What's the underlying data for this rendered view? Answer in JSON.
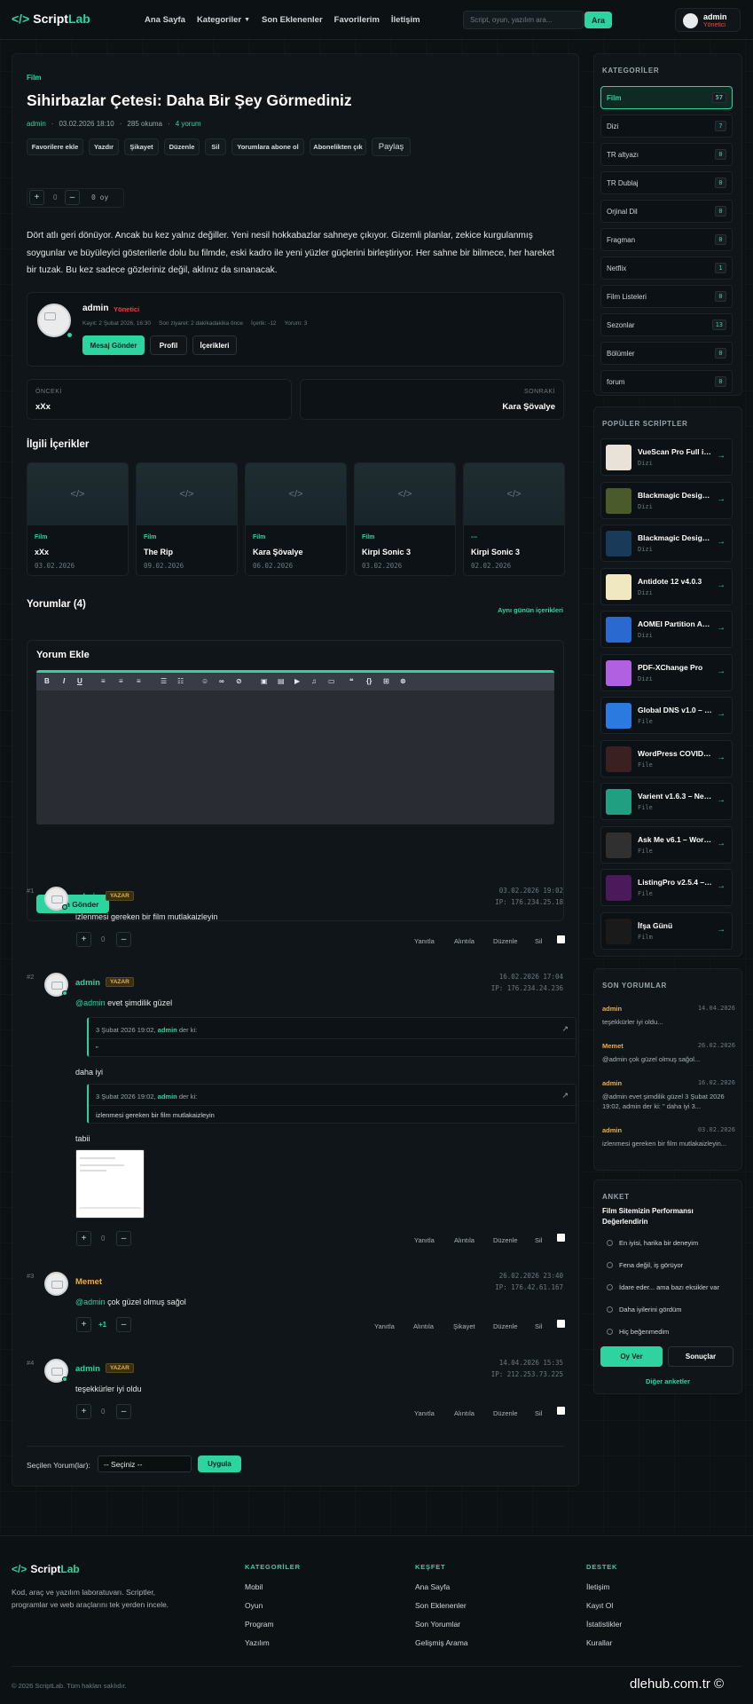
{
  "header": {
    "logo_bracket": "</>",
    "logo_script": "Script",
    "logo_lab": "Lab",
    "nav": [
      "Ana Sayfa",
      "Kategoriler",
      "Son Eklenenler",
      "Favorilerim",
      "İletişim"
    ],
    "search_placeholder": "Script, oyun, yazılım ara...",
    "search_button": "Ara",
    "user": {
      "name": "admin",
      "role": "Yönetici"
    }
  },
  "post": {
    "category": "Film",
    "title": "Sihirbazlar Çetesi: Daha Bir Şey Görmediniz",
    "author": "admin",
    "date": "03.02.2026 18:10",
    "reads": "285 okuma",
    "comments": "4 yorum",
    "actions": [
      "Favorilere ekle",
      "Yazdır",
      "Şikayet",
      "Düzenle",
      "Sil",
      "Yorumlara abone ol",
      "Abonelikten çık",
      "Paylaş"
    ],
    "vote": {
      "plus": "+",
      "count": "0",
      "minus": "–",
      "label": "0 oy"
    },
    "body": "Dört atlı geri dönüyor. Ancak bu kez yalnız değiller. Yeni nesil hokkabazlar sahneye çıkıyor. Gizemli planlar, zekice kurgulanmış soygunlar ve büyüleyici gösterilerle dolu bu filmde, eski kadro ile yeni yüzler güçlerini birleştiriyor. Her sahne bir bilmece, her hareket bir tuzak. Bu kez sadece gözleriniz değil, aklınız da sınanacak."
  },
  "author_card": {
    "name": "admin",
    "role": "Yönetici",
    "joined": "Kayıt: 2 Şubat 2026, 16:30",
    "last": "Son ziyaret: 2 dakikadakika önce",
    "content": "İçerik: -12",
    "comments": "Yorum: 3",
    "buttons": [
      "Mesaj Gönder",
      "Profil",
      "İçerikleri"
    ]
  },
  "prevnext": {
    "prev_label": "ÖNCEKİ",
    "prev_title": "xXx",
    "next_label": "SONRAKİ",
    "next_title": "Kara Şövalye"
  },
  "related": {
    "title": "İlgili İçerikler",
    "items": [
      {
        "cat": "Film",
        "title": "xXx",
        "date": "03.02.2026"
      },
      {
        "cat": "Film",
        "title": "The Rip",
        "date": "09.02.2026"
      },
      {
        "cat": "Film",
        "title": "Kara Şövalye",
        "date": "06.02.2026"
      },
      {
        "cat": "Film",
        "title": "Kirpi Sonic 3",
        "date": "03.02.2026"
      },
      {
        "cat": "---",
        "title": "Kirpi Sonic 3",
        "date": "02.02.2026"
      }
    ]
  },
  "comments": {
    "title": "Yorumlar (4)",
    "same_day": "Aynı günün içerikleri",
    "add_title": "Yorum Ekle",
    "submit": "Yorum Gönder",
    "items": [
      {
        "num": "#1",
        "name": "admin",
        "badge": "YAZAR",
        "date": "03.02.2026 19:02",
        "ip": "IP: 176.234.25.18",
        "text": "izlenmesi gereken bir film mutlakaizleyin",
        "score": "0",
        "actions": [
          "Yanıtla",
          "Alıntıla",
          "Düzenle",
          "Sil"
        ]
      },
      {
        "num": "#2",
        "name": "admin",
        "badge": "YAZAR",
        "date": "16.02.2026 17:04",
        "ip": "IP: 176.234.24.236",
        "mention": "@admin",
        "text": " evet şimdilik güzel",
        "q1_head": "3 Şubat 2026 19:02,",
        "q1_user": "admin",
        "q1_tail": "der ki:",
        "q1_text": "\"",
        "mid": "daha iyi",
        "q2_head": "3 Şubat 2026 19:02,",
        "q2_user": "admin",
        "q2_tail": "der ki:",
        "q2_text": "izlenmesi gereken bir film mutlakaizleyin",
        "tail": "tabii",
        "score": "0",
        "actions": [
          "Yanıtla",
          "Alıntıla",
          "Düzenle",
          "Sil"
        ]
      },
      {
        "num": "#3",
        "name": "Memet",
        "date": "26.02.2026 23:40",
        "ip": "IP: 176.42.61.167",
        "mention": "@admin",
        "text": " çok güzel olmuş sağol",
        "score": "+1",
        "actions": [
          "Yanıtla",
          "Alıntıla",
          "Şikayet",
          "Düzenle",
          "Sil"
        ]
      },
      {
        "num": "#4",
        "name": "admin",
        "badge": "YAZAR",
        "date": "14.04.2026 15:35",
        "ip": "IP: 212.253.73.225",
        "text": "teşekkürler iyi oldu",
        "score": "0",
        "actions": [
          "Yanıtla",
          "Alıntıla",
          "Düzenle",
          "Sil"
        ]
      }
    ],
    "bulk_label": "Seçilen Yorum(lar):",
    "bulk_select": "-- Seçiniz --",
    "bulk_apply": "Uygula"
  },
  "sidebar": {
    "categories_title": "KATEGORİLER",
    "categories": [
      {
        "name": "Film",
        "count": "57"
      },
      {
        "name": "Dizi",
        "count": "7"
      },
      {
        "name": "TR altyazı",
        "count": "0"
      },
      {
        "name": "TR Dublaj",
        "count": "0"
      },
      {
        "name": "Orjinal Dil",
        "count": "0"
      },
      {
        "name": "Fragman",
        "count": "0"
      },
      {
        "name": "Netflix",
        "count": "1"
      },
      {
        "name": "Film Listeleri",
        "count": "0"
      },
      {
        "name": "Sezonlar",
        "count": "13"
      },
      {
        "name": "Bölümler",
        "count": "0"
      },
      {
        "name": "forum",
        "count": "0"
      }
    ],
    "popular_title": "POPÜLER SCRİPTLER",
    "popular": [
      {
        "title": "VueScan Pro Full indir",
        "cat": "Dizi",
        "color": "#e8e2d8"
      },
      {
        "title": "Blackmagic Design DaVinci",
        "cat": "Dizi",
        "color": "#4a5a2a"
      },
      {
        "title": "Blackmagic Design Fusion",
        "cat": "Dizi",
        "color": "#1a3a5a"
      },
      {
        "title": "Antidote 12 v4.0.3",
        "cat": "Dizi",
        "color": "#f0e8c0"
      },
      {
        "title": "AOMEI Partition Assistant",
        "cat": "Dizi",
        "color": "#2a6ad0"
      },
      {
        "title": "PDF-XChange Pro",
        "cat": "Dizi",
        "color": "#b060e0"
      },
      {
        "title": "Global DNS v1.0 – Multi",
        "cat": "File",
        "color": "#2a7ae0"
      },
      {
        "title": "WordPress COVID-19",
        "cat": "File",
        "color": "#3a2020"
      },
      {
        "title": "Varient v1.6.3 – News",
        "cat": "File",
        "color": "#20a080"
      },
      {
        "title": "Ask Me v6.1 – WordPress",
        "cat": "File",
        "color": "#303030"
      },
      {
        "title": "ListingPro v2.5.4 – Directory",
        "cat": "File",
        "color": "#4a1a5a"
      },
      {
        "title": "İfşa Günü",
        "cat": "Film",
        "color": "#1a1a1a"
      }
    ],
    "recent_title": "SON YORUMLAR",
    "recent": [
      {
        "author": "admin",
        "date": "14.04.2026",
        "text": "teşekkürler iyi oldu..."
      },
      {
        "author": "Memet",
        "date": "26.02.2026",
        "text": "@admin çok güzel olmuş sağol..."
      },
      {
        "author": "admin",
        "date": "16.02.2026",
        "text": "@admin evet şimdilik güzel 3 Şubat 2026 19:02, admin der ki: \" daha iyi 3..."
      },
      {
        "author": "admin",
        "date": "03.02.2026",
        "text": "izlenmesi gereken bir film mutlakaizleyin..."
      }
    ],
    "poll_title": "ANKET",
    "poll_question": "Film Sitemizin Performansı Değerlendirin",
    "poll_options": [
      "En iyisi, harika bir deneyim",
      "Fena değil, iş görüyor",
      "İdare eder... ama bazı eksikler var",
      "Daha iyilerini gördüm",
      "Hiç beğenmedim"
    ],
    "poll_vote": "Oy Ver",
    "poll_results": "Sonuçlar",
    "poll_other": "Diğer anketler"
  },
  "footer": {
    "desc": "Kod, araç ve yazılım laboratuvarı. Scriptler, programlar ve web araçlarını tek yerden incele.",
    "cols": [
      {
        "title": "KATEGORİLER",
        "links": [
          "Mobil",
          "Oyun",
          "Program",
          "Yazılım"
        ]
      },
      {
        "title": "KEŞFET",
        "links": [
          "Ana Sayfa",
          "Son Eklenenler",
          "Son Yorumlar",
          "Gelişmiş Arama"
        ]
      },
      {
        "title": "DESTEK",
        "links": [
          "İletişim",
          "Kayıt Ol",
          "İstatistikler",
          "Kurallar"
        ]
      }
    ],
    "copyright": "© 2026 ScriptLab. Tüm hakları saklıdır.",
    "watermark": "dlehub.com.tr ©"
  }
}
